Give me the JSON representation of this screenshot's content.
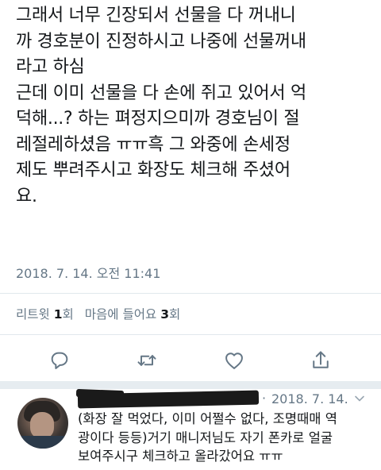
{
  "tweet": {
    "lines": [
      "그래서 너무 긴장되서 선물을 다 꺼내니",
      "까 경호분이 진정하시고 나중에 선물꺼내",
      "라고 하심",
      "근데 이미 선물을 다 손에 쥐고 있어서 억",
      "덕해...? 하는 펴정지으미까 경호님이 절",
      "레절레하셨음 ㅠㅠ흑  그 와중에 손세정",
      "제도 뿌려주시고 화장도 체크해 주셨어",
      "요."
    ],
    "timestamp": "2018. 7. 14. 오전 11:41"
  },
  "stats": {
    "retweet_label": "리트윗",
    "retweet_count": "1",
    "retweet_unit": "회",
    "like_label": "마음에 들어요",
    "like_count": "3",
    "like_unit": "회"
  },
  "actions": {
    "icons": [
      "reply-icon",
      "retweet-icon",
      "like-icon",
      "share-icon"
    ],
    "icon_color": "#657786"
  },
  "reply": {
    "dot": "·",
    "date": "2018. 7. 14.",
    "lines": [
      "(화장 잘 먹었다, 이미 어쩔수 없다, 조명때매 역",
      "광이다 등등)거기 매니저님도 자기 폰카로 얼굴",
      "보여주시구 체크하고 올라갔어요 ㅠㅠ"
    ]
  }
}
